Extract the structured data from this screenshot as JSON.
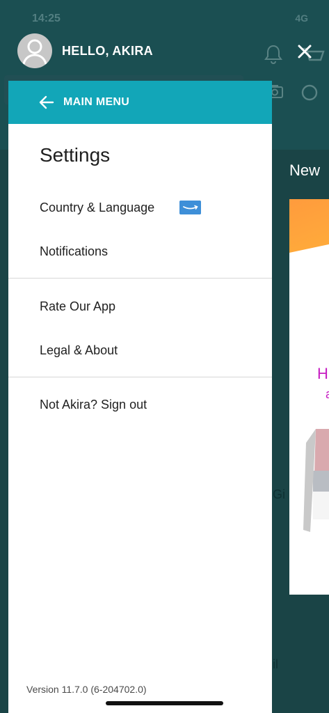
{
  "status_bar": {
    "time": "14:25",
    "network": "4G"
  },
  "drawer": {
    "greeting": "HELLO, AKIRA"
  },
  "settings_panel": {
    "back_label": "MAIN MENU",
    "title": "Settings",
    "sections": [
      {
        "items": [
          {
            "label": "Country & Language"
          },
          {
            "label": "Notifications"
          }
        ]
      },
      {
        "items": [
          {
            "label": "Rate Our App"
          },
          {
            "label": "Legal & About"
          }
        ]
      },
      {
        "items": [
          {
            "label": "Not Akira? Sign out"
          }
        ]
      }
    ],
    "version": "Version 11.7.0 (6-204702.0)"
  },
  "background": {
    "panel_heading": "New",
    "card_text": "H",
    "card_subtext": "a",
    "side_text_1": "Gi",
    "side_text_2": "il"
  },
  "colors": {
    "teal_bar": "#12a6b8",
    "flag_blue": "#3e8fd8",
    "overlay_teal": "#1b4f52"
  }
}
